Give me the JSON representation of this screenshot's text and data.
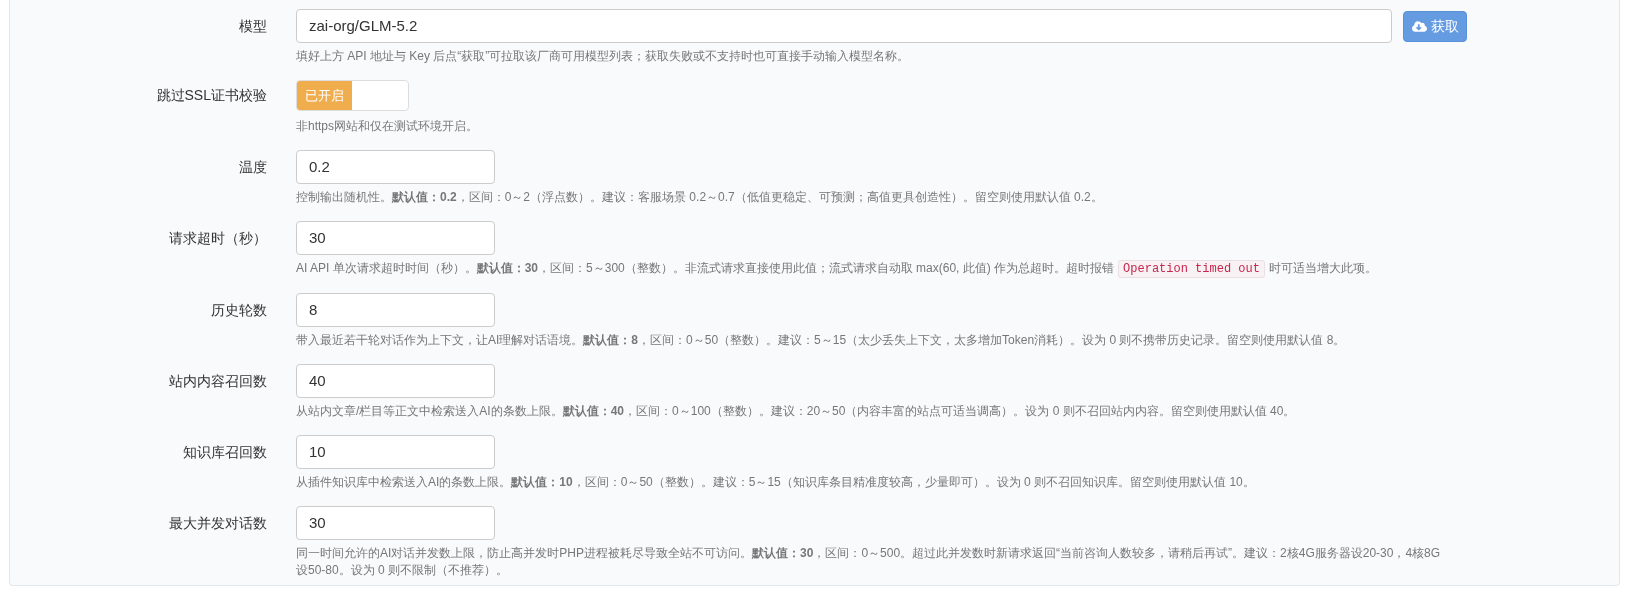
{
  "fields": [
    {
      "kind": "text_button",
      "label": "模型",
      "value": "zai-org/GLM-5.2",
      "button": "获取",
      "help": [
        {
          "kind": "text",
          "text": "填好上方 API 地址与 Key 后点“获取”可拉取该厂商可用模型列表；获取失败或不支持时也可直接手动输入模型名称。"
        }
      ]
    },
    {
      "kind": "toggle",
      "label": "跳过SSL证书校验",
      "on": true,
      "state_text": "已开启",
      "help": [
        {
          "kind": "text",
          "text": "非https网站和仅在测试环境开启。"
        }
      ]
    },
    {
      "kind": "number",
      "label": "温度",
      "value": "0.2",
      "help": [
        {
          "kind": "text",
          "text": "控制输出随机性。**默认值：0.2**，区间：0～2（浮点数）。建议：客服场景 0.2～0.7（低值更稳定、可预测；高值更具创造性）。留空则使用默认值 0.2。"
        }
      ]
    },
    {
      "kind": "number",
      "label": "请求超时（秒）",
      "value": "30",
      "help": [
        {
          "kind": "text",
          "text": "AI API 单次请求超时时间（秒）。**默认值：30**，区间：5～300（整数）。非流式请求直接使用此值；流式请求自动取 max(60, 此值) 作为总超时。超时报错"
        },
        {
          "kind": "code",
          "text": "Operation timed out"
        },
        {
          "kind": "text",
          "text": "时可适当增大此项。"
        }
      ]
    },
    {
      "kind": "number",
      "label": "历史轮数",
      "value": "8",
      "help": [
        {
          "kind": "text",
          "text": "带入最近若干轮对话作为上下文，让AI理解对话语境。**默认值：8**，区间：0～50（整数）。建议：5～15（太少丢失上下文，太多增加Token消耗）。设为 0 则不携带历史记录。留空则使用默认值 8。"
        }
      ]
    },
    {
      "kind": "number",
      "label": "站内内容召回数",
      "value": "40",
      "help": [
        {
          "kind": "text",
          "text": "从站内文章/栏目等正文中检索送入AI的条数上限。**默认值：40**，区间：0～100（整数）。建议：20～50（内容丰富的站点可适当调高）。设为 0 则不召回站内内容。留空则使用默认值 40。"
        }
      ]
    },
    {
      "kind": "number",
      "label": "知识库召回数",
      "value": "10",
      "help": [
        {
          "kind": "text",
          "text": "从插件知识库中检索送入AI的条数上限。**默认值：10**，区间：0～50（整数）。建议：5～15（知识库条目精准度较高，少量即可）。设为 0 则不召回知识库。留空则使用默认值 10。"
        }
      ]
    },
    {
      "kind": "number",
      "label": "最大并发对话数",
      "value": "30",
      "help": [
        {
          "kind": "text",
          "text": "同一时间允许的AI对话并发数上限，防止高并发时PHP进程被耗尽导致全站不可访问。**默认值：30**，区间：0～500。超过此并发数时新请求返回“当前咨询人数较多，请稍后再试”。建议：2核4G服务器设20-30，4核8G设50-80。设为 0 则不限制（不推荐）。"
        }
      ]
    }
  ]
}
